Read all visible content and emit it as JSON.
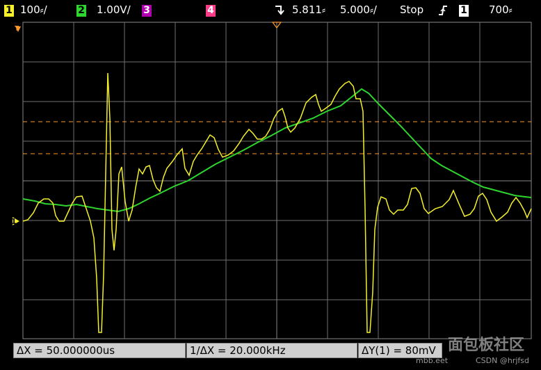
{
  "status": {
    "ch1_num": "1",
    "ch1_scale": "100⸗/",
    "ch2_num": "2",
    "ch2_scale": "1.00V/",
    "ch3_num": "3",
    "ch4_num": "4",
    "trig_icon": "trigger-arrow-icon",
    "timebase_pos": "5.811⸗",
    "timebase_scale": "5.000⸗/",
    "run_state": "Stop",
    "edge_icon": "rising-edge-icon",
    "trig_ch": "1",
    "trig_level": "700⸗"
  },
  "colors": {
    "ch1": "#f5f02a",
    "ch2": "#2ed52e",
    "ch3": "#b000b0",
    "ch4": "#ff3b8a",
    "cursor": "#ff9a2a",
    "grid": "#707070"
  },
  "markers": {
    "ch1_ground": "1",
    "trig_marker": "T"
  },
  "measurements": {
    "delta_x": "ΔX = 50.000000us",
    "inv_delta_x": "1/ΔX = 20.000kHz",
    "delta_y": "ΔY(1) = 80mV"
  },
  "watermark": {
    "main": "面包板社区",
    "sub": "CSDN @hrjfsd",
    "url": "mbb.eet"
  }
}
